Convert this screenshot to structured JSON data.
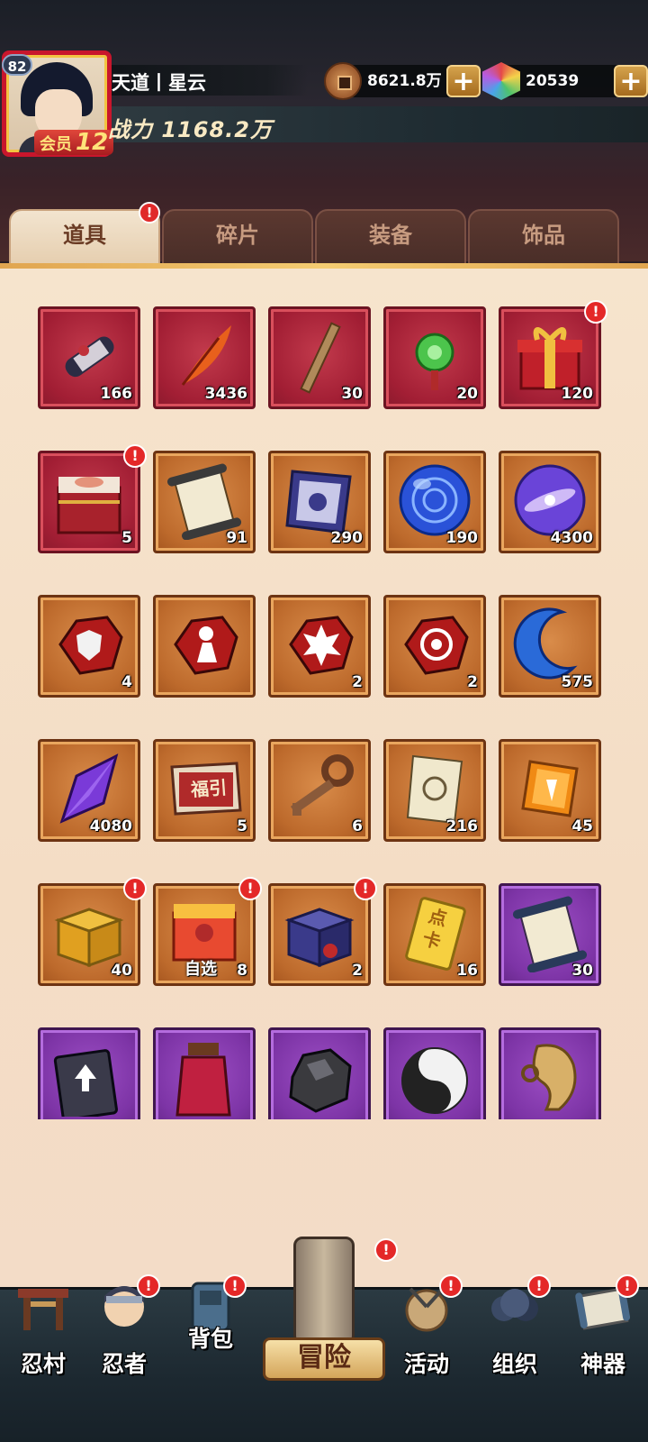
{
  "player": {
    "level": "82",
    "name": "天道丨星云",
    "power": "战力 1168.2万",
    "vip_label": "会员",
    "vip_level": "12"
  },
  "currency": {
    "coins": "8621.8万",
    "gems": "20539",
    "add_label": "+"
  },
  "tabs": [
    {
      "label": "道具",
      "active": true,
      "alert": true
    },
    {
      "label": "碎片",
      "active": false,
      "alert": false
    },
    {
      "label": "装备",
      "active": false,
      "alert": false
    },
    {
      "label": "饰品",
      "active": false,
      "alert": false
    }
  ],
  "alert_mark": "!",
  "items": [
    {
      "icon": "scroll-icon",
      "count": "166",
      "rarity": "red",
      "alert": false
    },
    {
      "icon": "feather-icon",
      "count": "3436",
      "rarity": "red",
      "alert": false
    },
    {
      "icon": "stick-icon",
      "count": "30",
      "rarity": "red",
      "alert": false
    },
    {
      "icon": "jade-pendant-icon",
      "count": "20",
      "rarity": "red",
      "alert": false
    },
    {
      "icon": "gift-box-icon",
      "count": "120",
      "rarity": "red",
      "alert": true
    },
    {
      "icon": "treasure-chest-icon",
      "count": "5",
      "rarity": "red",
      "alert": true
    },
    {
      "icon": "paper-scroll-icon",
      "count": "91",
      "rarity": "orange",
      "alert": false
    },
    {
      "icon": "banner-icon",
      "count": "290",
      "rarity": "orange",
      "alert": false
    },
    {
      "icon": "blue-orb-icon",
      "count": "190",
      "rarity": "orange",
      "alert": false
    },
    {
      "icon": "purple-orb-icon",
      "count": "4300",
      "rarity": "orange",
      "alert": false
    },
    {
      "icon": "shield-stone-icon",
      "count": "4",
      "rarity": "orange",
      "alert": false
    },
    {
      "icon": "figure-stone-icon",
      "count": "",
      "rarity": "orange",
      "alert": false
    },
    {
      "icon": "burst-stone-icon",
      "count": "2",
      "rarity": "orange",
      "alert": false
    },
    {
      "icon": "target-stone-icon",
      "count": "2",
      "rarity": "orange",
      "alert": false
    },
    {
      "icon": "crescent-moon-icon",
      "count": "575",
      "rarity": "orange",
      "alert": false
    },
    {
      "icon": "purple-crystal-icon",
      "count": "4080",
      "rarity": "orange",
      "alert": false
    },
    {
      "icon": "fortune-banner-icon",
      "count": "5",
      "rarity": "orange",
      "alert": false
    },
    {
      "icon": "key-icon",
      "count": "6",
      "rarity": "orange",
      "alert": false
    },
    {
      "icon": "talisman-icon",
      "count": "216",
      "rarity": "orange",
      "alert": false
    },
    {
      "icon": "amber-gem-icon",
      "count": "45",
      "rarity": "orange",
      "alert": false
    },
    {
      "icon": "gold-box-icon",
      "count": "40",
      "rarity": "orange",
      "alert": true
    },
    {
      "icon": "select-box-icon",
      "count": "8",
      "sublabel": "自选",
      "rarity": "orange",
      "alert": true
    },
    {
      "icon": "purple-box-icon",
      "count": "2",
      "rarity": "orange",
      "alert": true
    },
    {
      "icon": "point-card-icon",
      "count": "16",
      "rarity": "orange",
      "alert": false
    },
    {
      "icon": "purple-scroll-icon",
      "count": "30",
      "rarity": "purple",
      "alert": false
    },
    {
      "icon": "book-icon",
      "count": "",
      "rarity": "purple",
      "alert": false
    },
    {
      "icon": "potion-jar-icon",
      "count": "",
      "rarity": "purple",
      "alert": false
    },
    {
      "icon": "dark-ore-icon",
      "count": "",
      "rarity": "purple",
      "alert": false
    },
    {
      "icon": "yin-yang-icon",
      "count": "",
      "rarity": "purple",
      "alert": false
    },
    {
      "icon": "gold-ornament-icon",
      "count": "",
      "rarity": "purple",
      "alert": false
    }
  ],
  "point_card_text": "点卡",
  "fortune_text": "福引",
  "nav": [
    {
      "label": "忍村",
      "badge": false
    },
    {
      "label": "忍者",
      "badge": true
    },
    {
      "label": "背包",
      "badge": true
    },
    {
      "label": "冒险",
      "badge": true
    },
    {
      "label": "活动",
      "badge": true
    },
    {
      "label": "组织",
      "badge": true
    },
    {
      "label": "神器",
      "badge": true
    }
  ],
  "colors": {
    "alert": "#e42828",
    "tab_active": "#f2e4cf",
    "rarity_red": "#a21e34",
    "rarity_orange": "#bd6a2c",
    "rarity_purple": "#7d34a6"
  }
}
